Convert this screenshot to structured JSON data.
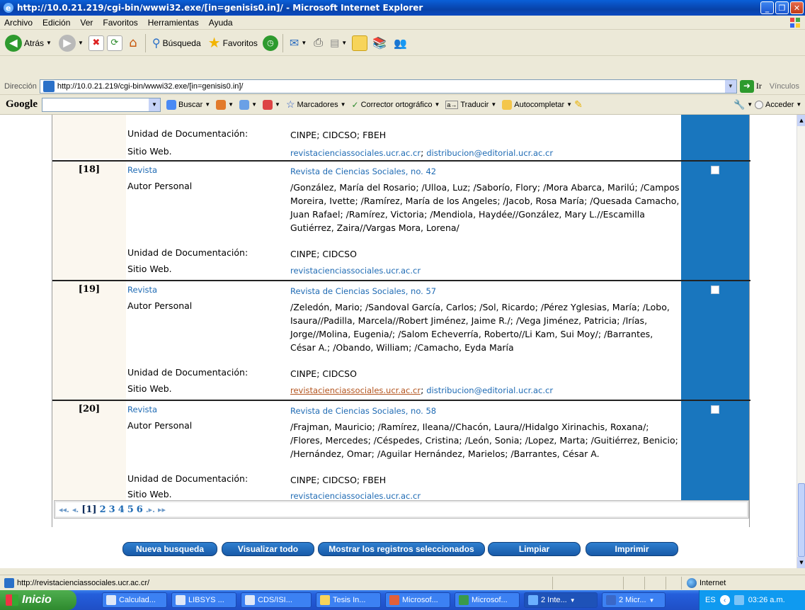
{
  "window": {
    "title": "http://10.0.21.219/cgi-bin/wwwi32.exe/[in=genisis0.in]/ - Microsoft Internet Explorer"
  },
  "menu": [
    "Archivo",
    "Edición",
    "Ver",
    "Favoritos",
    "Herramientas",
    "Ayuda"
  ],
  "toolbar": {
    "back": "Atrás",
    "search": "Búsqueda",
    "favorites": "Favoritos"
  },
  "address": {
    "label": "Dirección",
    "url": "http://10.0.21.219/cgi-bin/wwwi32.exe/[in=genisis0.in]/",
    "go": "Ir",
    "links": "Vínculos"
  },
  "google": {
    "logo": "Google",
    "buscar": "Buscar",
    "marcadores": "Marcadores",
    "corrector": "Corrector ortográfico",
    "traducir": "Traducir",
    "autocompletar": "Autocompletar",
    "acceder": "Acceder"
  },
  "partial_record": {
    "unidad_label": "Unidad de Documentación:",
    "unidad": "CINPE; CIDCSO; FBEH",
    "sitio_label": "Sitio Web.",
    "sitio": "revistacienciassociales.ucr.ac.cr",
    "sitio2": "distribucion@editorial.ucr.ac.cr"
  },
  "records": [
    {
      "num": "[18]",
      "tipo_label": "Revista",
      "tipo": "Revista de Ciencias Sociales, no. 42",
      "autor_label": "Autor Personal",
      "autor": "/González, María del Rosario; /Ulloa, Luz; /Saborío, Flory; /Mora Abarca, Marilú; /Campos Moreira, Ivette; /Ramírez, María de los Angeles; /Jacob, Rosa María; /Quesada Camacho, Juan Rafael; /Ramírez, Victoria; /Mendiola, Haydée//González, Mary L.//Escamilla Gutiérrez, Zaira//Vargas Mora, Lorena/",
      "unidad_label": "Unidad de Documentación:",
      "unidad": "CINPE; CIDCSO",
      "sitio_label": "Sitio Web.",
      "sitio": "revistacienciassociales.ucr.ac.cr",
      "sitio2": ""
    },
    {
      "num": "[19]",
      "tipo_label": "Revista",
      "tipo": "Revista de Ciencias Sociales, no. 57",
      "autor_label": "Autor Personal",
      "autor": "/Zeledón, Mario; /Sandoval García, Carlos; /Sol, Ricardo; /Pérez Yglesias, María; /Lobo, Isaura//Padilla, Marcela//Robert Jiménez, Jaime R./; /Vega Jiménez, Patricia; /Irías, Jorge//Molina, Eugenia/; /Salom Echeverría, Roberto//Li Kam, Sui Moy/; /Barrantes, César A.; /Obando, William; /Camacho, Eyda María",
      "unidad_label": "Unidad de Documentación:",
      "unidad": "CINPE; CIDCSO",
      "sitio_label": "Sitio Web.",
      "sitio": "revistacienciassociales.ucr.ac.cr",
      "sitio2": "distribucion@editorial.ucr.ac.cr"
    },
    {
      "num": "[20]",
      "tipo_label": "Revista",
      "tipo": "Revista de Ciencias Sociales, no. 58",
      "autor_label": "Autor Personal",
      "autor": "/Frajman, Mauricio; /Ramírez, Ileana//Chacón, Laura//Hidalgo Xirinachis, Roxana/; /Flores, Mercedes; /Céspedes, Cristina; /León, Sonia; /Lopez, Marta; /Guitiérrez, Benicio; /Hernández, Omar; /Aguilar Hernández, Marielos; /Barrantes, César A.",
      "unidad_label": "Unidad de Documentación:",
      "unidad": "CINPE; CIDCSO; FBEH",
      "sitio_label": "Sitio Web.",
      "sitio": "revistacienciassociales.ucr.ac.cr",
      "sitio2": ""
    }
  ],
  "pager": {
    "first": "◂◂.",
    "prev": "◂.",
    "current": "[1]",
    "pages": [
      "2",
      "3",
      "4",
      "5",
      "6"
    ],
    "next": ".▸.",
    "last": "▸▸"
  },
  "buttons": {
    "nueva": "Nueva busqueda",
    "visualizar": "Visualizar todo",
    "mostrar": "Mostrar los registros seleccionados",
    "limpiar": "Limpiar",
    "imprimir": "Imprimir"
  },
  "status": {
    "url": "http://revistacienciassociales.ucr.ac.cr/",
    "zone": "Internet"
  },
  "taskbar": {
    "start": "Inicio",
    "tasks": [
      "Calculad...",
      "LIBSYS ...",
      "CDS/ISI...",
      "Tesis In...",
      "Microsof...",
      "Microsof...",
      "2 Inte...",
      "2 Micr..."
    ],
    "lang": "ES",
    "time": "03:26 a.m."
  }
}
